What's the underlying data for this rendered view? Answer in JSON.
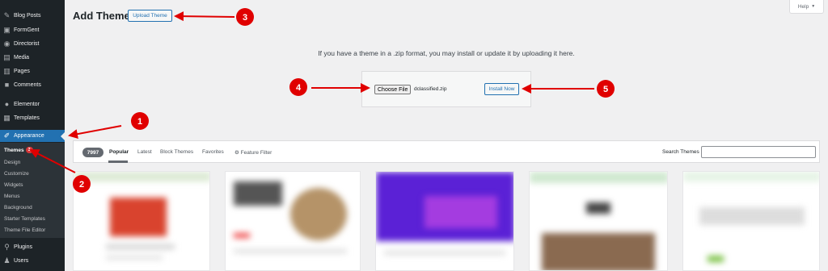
{
  "sidebar": {
    "items": [
      {
        "label": "Blog Posts",
        "icon": "pin-icon"
      },
      {
        "label": "FormGent",
        "icon": "form-icon"
      },
      {
        "label": "Directorist",
        "icon": "directory-icon"
      },
      {
        "label": "Media",
        "icon": "media-icon"
      },
      {
        "label": "Pages",
        "icon": "pages-icon"
      },
      {
        "label": "Comments",
        "icon": "comment-icon"
      },
      {
        "label": "Elementor",
        "icon": "elementor-icon"
      },
      {
        "label": "Templates",
        "icon": "templates-icon"
      },
      {
        "label": "Appearance",
        "icon": "brush-icon"
      },
      {
        "label": "Plugins",
        "icon": "plugin-icon"
      },
      {
        "label": "Users",
        "icon": "user-icon"
      }
    ],
    "submenu": [
      {
        "label": "Themes",
        "badge": "3"
      },
      {
        "label": "Design"
      },
      {
        "label": "Customize"
      },
      {
        "label": "Widgets"
      },
      {
        "label": "Menus"
      },
      {
        "label": "Background"
      },
      {
        "label": "Starter Templates"
      },
      {
        "label": "Theme File Editor"
      }
    ]
  },
  "header": {
    "title": "Add Themes",
    "upload_button": "Upload Theme",
    "help": "Help"
  },
  "upload": {
    "description": "If you have a theme in a .zip format, you may install or update it by uploading it here.",
    "choose_file": "Choose File",
    "file_name": "dclassified.zip",
    "install_button": "Install Now"
  },
  "filter": {
    "count": "7997",
    "tabs": [
      "Popular",
      "Latest",
      "Block Themes",
      "Favorites",
      "Feature Filter"
    ],
    "search_label": "Search Themes",
    "search_value": ""
  },
  "markers": [
    "1",
    "2",
    "3",
    "4",
    "5"
  ],
  "colors": {
    "sidebar_bg": "#1d2327",
    "accent": "#2271b1",
    "annotation": "#e00000"
  }
}
